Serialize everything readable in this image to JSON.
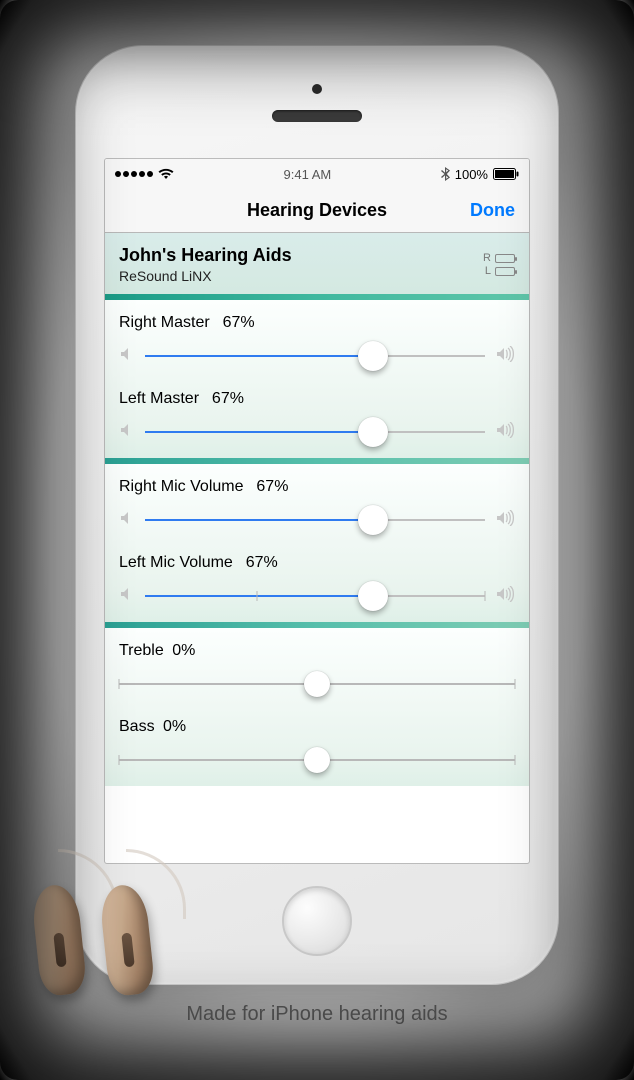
{
  "statusbar": {
    "time": "9:41 AM",
    "battery_text": "100%"
  },
  "navbar": {
    "title": "Hearing Devices",
    "done": "Done"
  },
  "device": {
    "name": "John's Hearing Aids",
    "model": "ReSound LiNX",
    "right_label": "R",
    "left_label": "L"
  },
  "sliders": {
    "right_master": {
      "label": "Right Master",
      "value": "67%",
      "pct": 67,
      "type": "volume"
    },
    "left_master": {
      "label": "Left Master",
      "value": "67%",
      "pct": 67,
      "type": "volume"
    },
    "right_mic": {
      "label": "Right Mic Volume",
      "value": "67%",
      "pct": 67,
      "type": "volume"
    },
    "left_mic": {
      "label": "Left Mic Volume",
      "value": "67%",
      "pct": 67,
      "type": "volume"
    },
    "treble": {
      "label": "Treble",
      "value": "0%",
      "pct": 50,
      "type": "eq"
    },
    "bass": {
      "label": "Bass",
      "value": "0%",
      "pct": 50,
      "type": "eq"
    }
  },
  "caption": "Made for iPhone hearing aids"
}
